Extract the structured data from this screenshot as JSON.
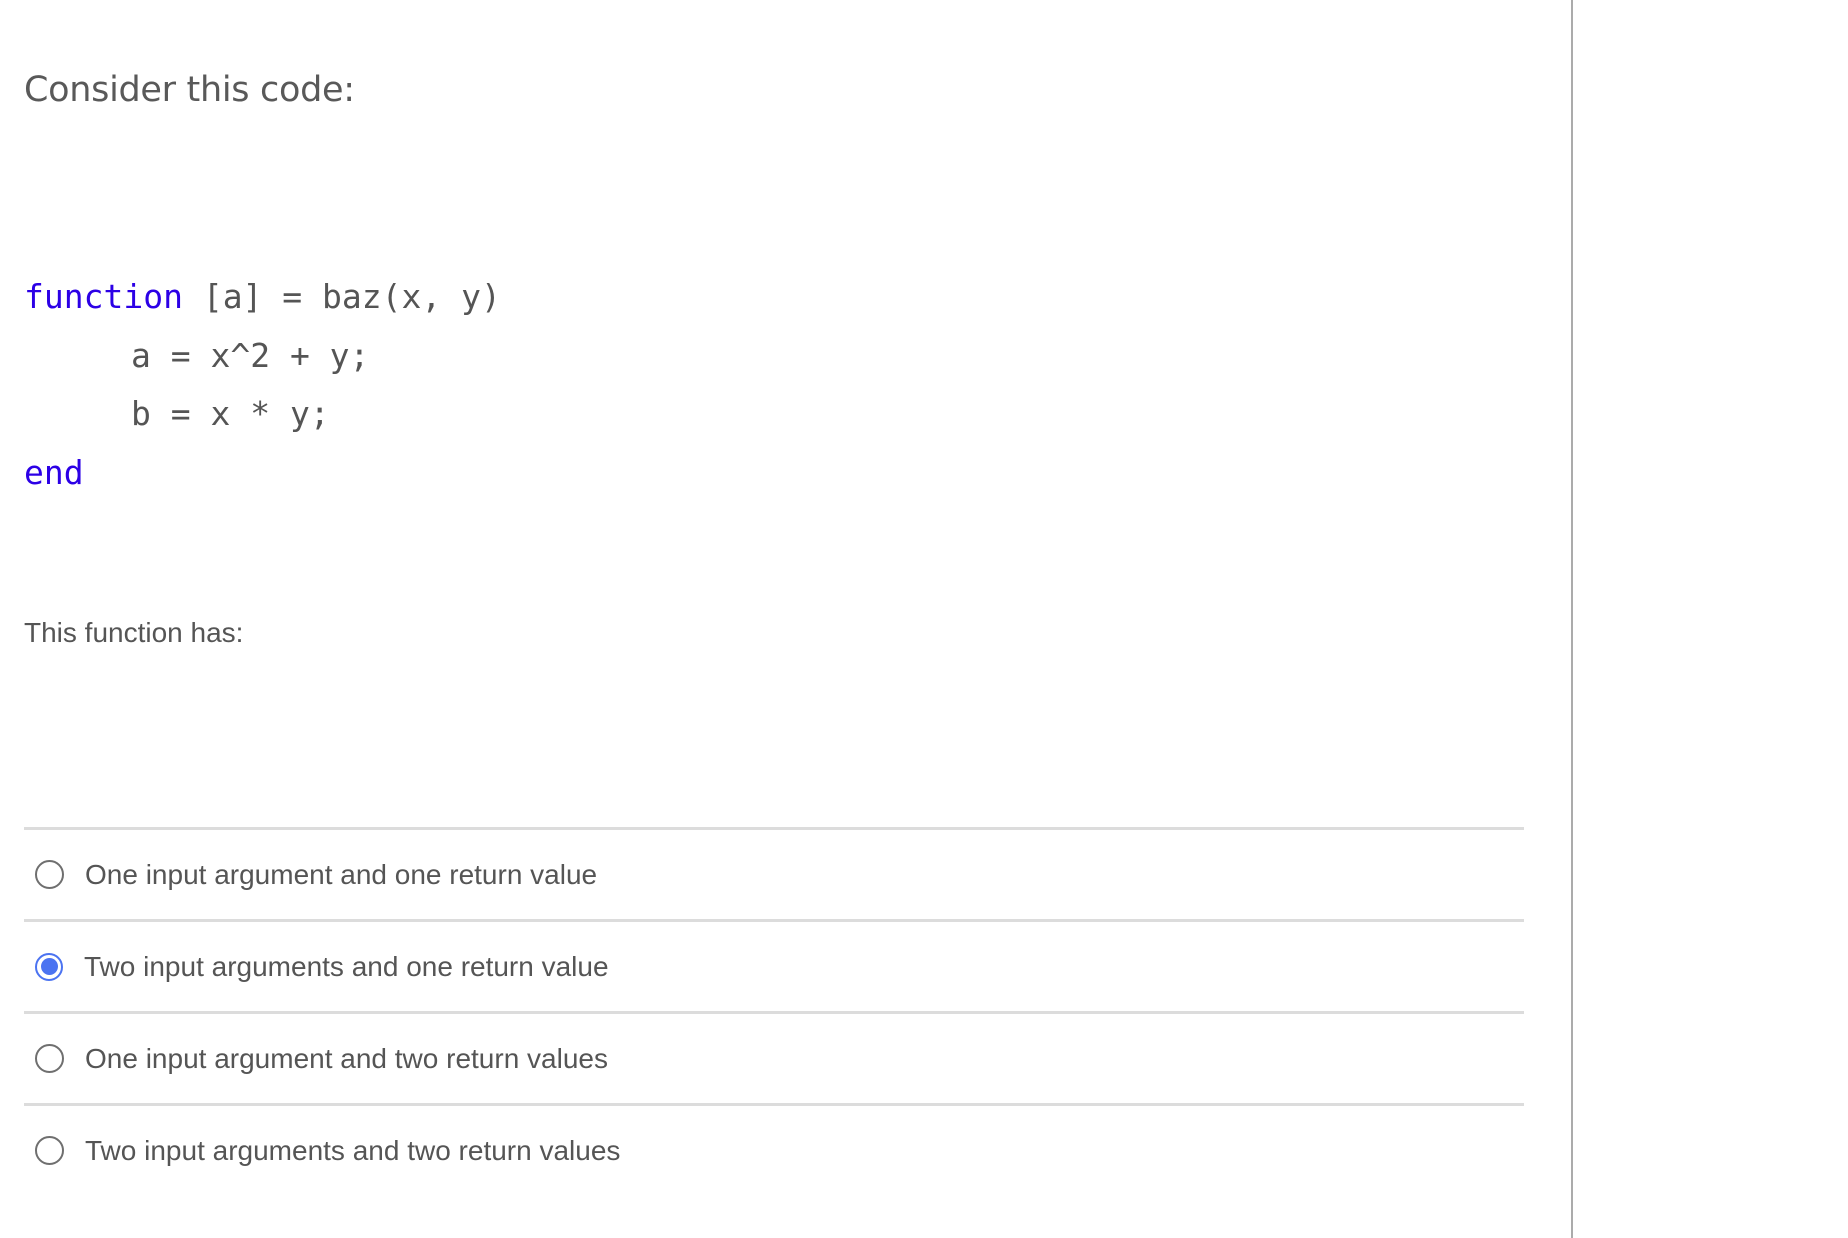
{
  "prompt": "Consider this code:",
  "code": {
    "lines": [
      {
        "keyword": "function",
        "rest": " [a] = baz(x, y)",
        "indented": false
      },
      {
        "keyword": "",
        "rest": "a = x^2 + y;",
        "indented": true
      },
      {
        "keyword": "",
        "rest": "b = x * y;",
        "indented": true
      },
      {
        "keyword": "end",
        "rest": "",
        "indented": false
      }
    ]
  },
  "question": "This function has:",
  "answers": [
    {
      "label": "One input argument and one return value",
      "selected": false
    },
    {
      "label": "Two input arguments and one return value",
      "selected": true
    },
    {
      "label": "One input argument and two return values",
      "selected": false
    },
    {
      "label": "Two input arguments and two return values",
      "selected": false
    }
  ],
  "colors": {
    "keyword": "#2c00e6",
    "text": "#555555",
    "radio_selected": "#4b73f1",
    "divider": "#dcdcdc",
    "sidebar_border": "#ababab"
  }
}
